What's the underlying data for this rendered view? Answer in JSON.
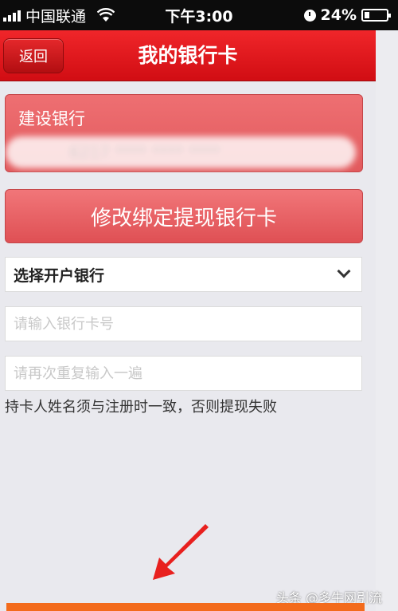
{
  "status_bar": {
    "carrier": "中国联通",
    "time": "下午3:00",
    "battery": "24%",
    "battery_level": 0.24
  },
  "header": {
    "back_label": "返回",
    "title": "我的银行卡"
  },
  "card": {
    "bank_name": "建设银行",
    "card_number_masked": "6217 **** **** ****"
  },
  "modify_button_label": "修改绑定提现银行卡",
  "form": {
    "bank_select_value": "选择开户银行",
    "card_number_placeholder": "请输入银行卡号",
    "repeat_placeholder": "请再次重复输入一遍",
    "hint": "持卡人姓名须与注册时一致，否则提现失败"
  },
  "watermark": "头条 @多牛网引流",
  "colors": {
    "header_red": "#e01a1e",
    "card_red": "#e8676a",
    "arrow_red": "#e8201e",
    "bottom_orange": "#f36b1c"
  }
}
